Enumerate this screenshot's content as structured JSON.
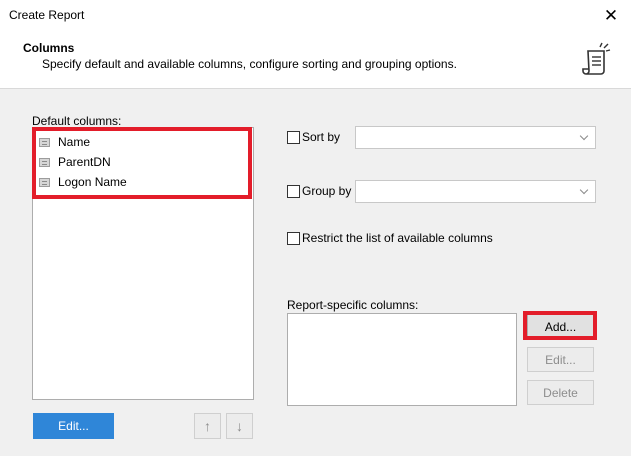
{
  "window": {
    "title": "Create Report"
  },
  "header": {
    "title": "Columns",
    "description": "Specify default and available columns, configure sorting and grouping options."
  },
  "default_columns": {
    "label": "Default columns:",
    "items": [
      {
        "label": "Name"
      },
      {
        "label": "ParentDN"
      },
      {
        "label": "Logon Name"
      }
    ],
    "edit_label": "Edit...",
    "up_glyph": "↑",
    "down_glyph": "↓"
  },
  "sort_by": {
    "label": "Sort by",
    "checked": false,
    "value": ""
  },
  "group_by": {
    "label": "Group by",
    "checked": false,
    "value": ""
  },
  "restrict": {
    "label": "Restrict the list of available columns",
    "checked": false
  },
  "report_columns": {
    "label": "Report-specific columns:",
    "add_label": "Add...",
    "edit_label": "Edit...",
    "delete_label": "Delete"
  },
  "icons": {
    "close": "close-icon",
    "report": "report-scroll-icon",
    "item": "column-item-icon"
  },
  "colors": {
    "highlight": "#e31d2a",
    "primary_button": "#2f86d8"
  }
}
